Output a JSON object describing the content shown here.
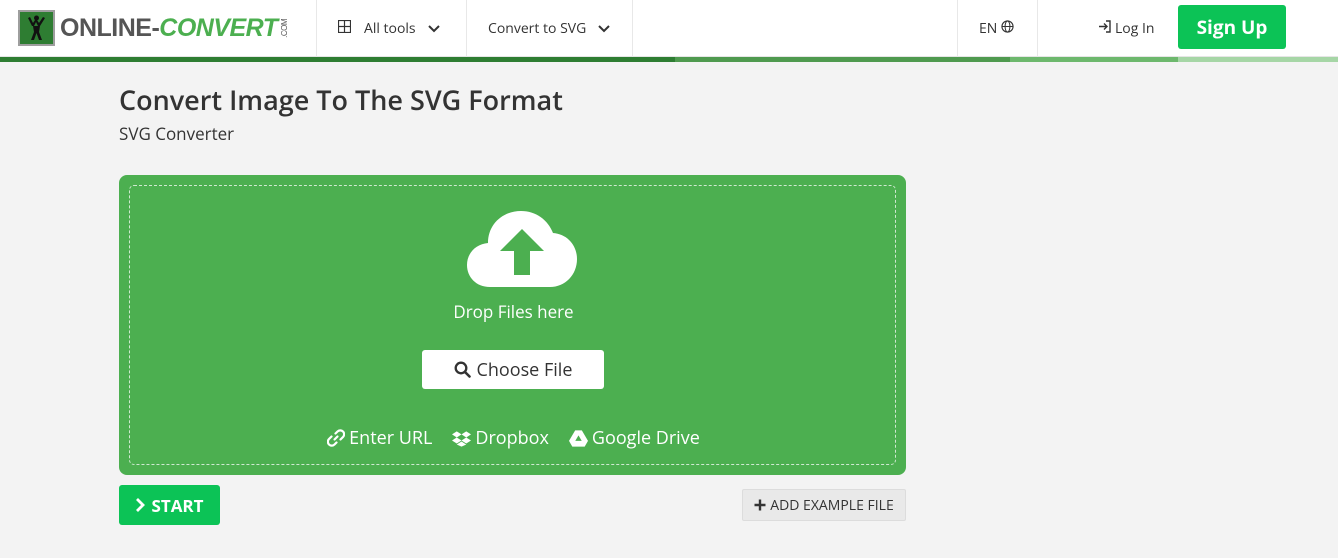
{
  "header": {
    "logo_text_1": "ONLINE-",
    "logo_text_2": "CONVERT",
    "logo_com": ".COM",
    "nav_all_tools": "All tools",
    "nav_convert": "Convert to SVG",
    "language": "EN",
    "login": "Log In",
    "signup": "Sign Up"
  },
  "main": {
    "title": "Convert Image To The SVG Format",
    "subtitle": "SVG Converter",
    "drop_text": "Drop Files here",
    "choose_file": "Choose File",
    "sources": {
      "url": "Enter URL",
      "dropbox": "Dropbox",
      "gdrive": "Google Drive"
    },
    "start": "START",
    "add_example": "ADD EXAMPLE FILE"
  },
  "colors": {
    "brand_green": "#4caf50",
    "cta_green": "#0cc356"
  }
}
